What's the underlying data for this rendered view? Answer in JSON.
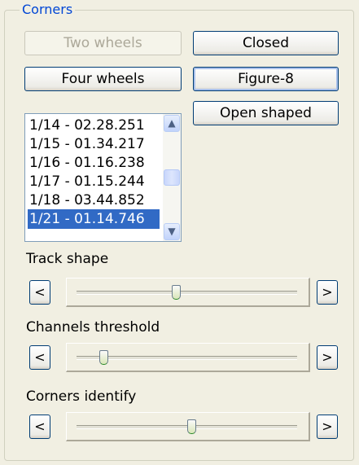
{
  "group": {
    "title": "Corners"
  },
  "buttons": {
    "two_wheels": "Two wheels",
    "four_wheels": "Four wheels",
    "closed": "Closed",
    "figure8": "Figure-8",
    "open_shaped": "Open shaped"
  },
  "laps": {
    "items": [
      "1/14 - 02.28.251",
      "1/15 - 01.34.217",
      "1/16 - 01.16.238",
      "1/17 - 01.15.244",
      "1/18 - 03.44.852",
      "1/21 - 01.14.746"
    ],
    "selected_index": 5
  },
  "sliders": [
    {
      "label": "Track shape",
      "left_btn": "<",
      "right_btn": ">",
      "value_fraction": 0.45
    },
    {
      "label": "Channels threshold",
      "left_btn": "<",
      "right_btn": ">",
      "value_fraction": 0.12
    },
    {
      "label": "Corners identify",
      "left_btn": "<",
      "right_btn": ">",
      "value_fraction": 0.52
    }
  ]
}
